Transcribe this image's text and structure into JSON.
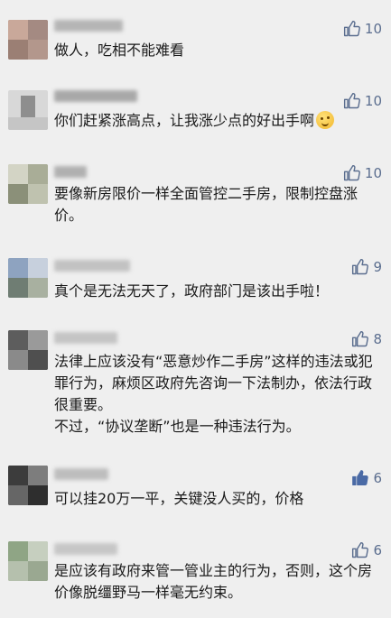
{
  "comments": [
    {
      "text": "做人，吃相不能难看",
      "likes": "10",
      "liked": false
    },
    {
      "text": "你们赶紧涨高点，让我涨少点的好出手啊",
      "likes": "10",
      "liked": false,
      "emoji": "thinking-face"
    },
    {
      "text": "要像新房限价一样全面管控二手房，限制控盘涨价。",
      "likes": "10",
      "liked": false
    },
    {
      "text": "真个是无法无天了，政府部门是该出手啦！",
      "likes": "9",
      "liked": false
    },
    {
      "text": "法律上应该没有“恶意炒作二手房”这样的违法或犯罪行为，麻烦区政府先咨询一下法制办，依法行政很重要。",
      "text2": "不过，“协议垄断”也是一种违法行为。",
      "likes": "8",
      "liked": false
    },
    {
      "text": "可以挂20万一平，关键没人买的，价格",
      "likes": "6",
      "liked": true
    },
    {
      "text": "是应该有政府来管一管业主的行为，否则，这个房价像脱缰野马一样毫无约束。",
      "likes": "6",
      "liked": false
    }
  ],
  "colors": {
    "like_icon": "#5b6e8f",
    "liked_icon": "#4a6aa5",
    "text": "#1a1a1a",
    "background": "#efefef"
  }
}
